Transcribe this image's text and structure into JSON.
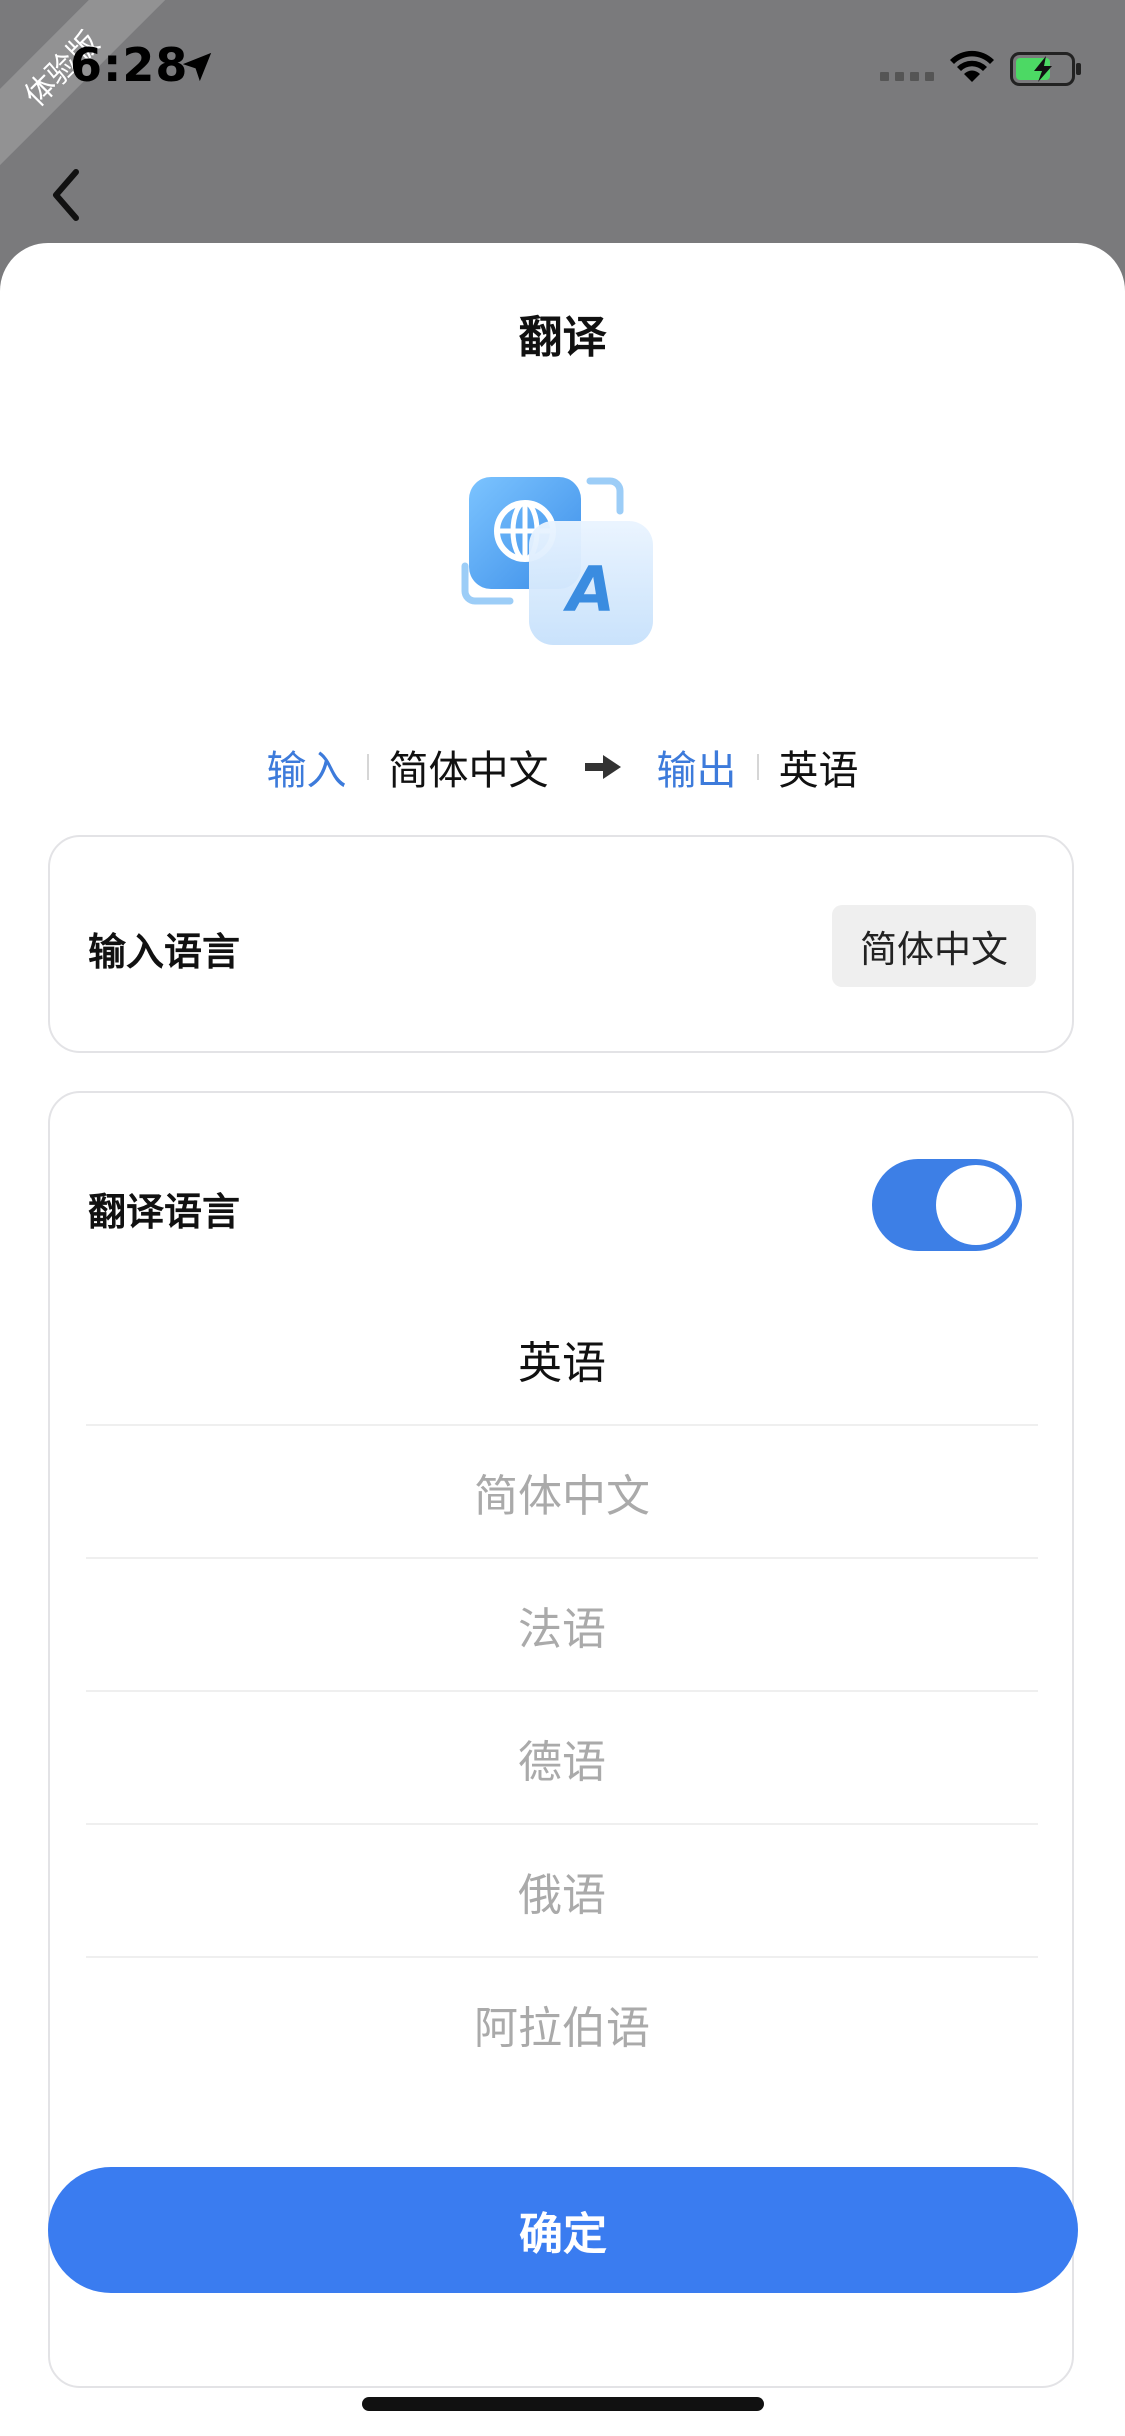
{
  "status_bar": {
    "time": "6:28",
    "ribbon": "体验版"
  },
  "sheet": {
    "title": "翻译",
    "summary": {
      "input_label": "输入",
      "input_lang": "简体中文",
      "output_label": "输出",
      "output_lang": "英语"
    },
    "input_card": {
      "label": "输入语言",
      "value": "简体中文"
    },
    "translate_card": {
      "label": "翻译语言",
      "toggle_on": true,
      "options": [
        "英语",
        "简体中文",
        "法语",
        "德语",
        "俄语",
        "阿拉伯语"
      ],
      "selected": "英语"
    },
    "confirm_label": "确定"
  },
  "colors": {
    "accent": "#3a7cf0",
    "link": "#3d7bdb"
  },
  "icons": [
    "location-arrow-icon",
    "wifi-icon",
    "battery-charging-icon",
    "back-chevron-icon",
    "translate-app-icon",
    "arrow-right-icon"
  ]
}
